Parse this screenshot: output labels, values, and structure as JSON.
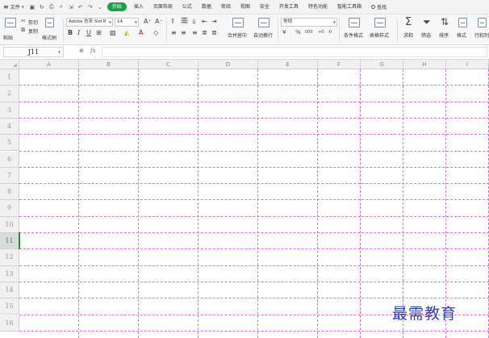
{
  "menubar": {
    "file_label": "文件",
    "tabs": [
      {
        "label": "开始",
        "active": true
      },
      {
        "label": "插入",
        "active": false
      },
      {
        "label": "页面布局",
        "active": false
      },
      {
        "label": "公式",
        "active": false
      },
      {
        "label": "数据",
        "active": false
      },
      {
        "label": "审阅",
        "active": false
      },
      {
        "label": "视图",
        "active": false
      },
      {
        "label": "安全",
        "active": false
      },
      {
        "label": "开发工具",
        "active": false
      },
      {
        "label": "特色功能",
        "active": false
      },
      {
        "label": "智能工具箱",
        "active": false
      }
    ],
    "search_label": "查找",
    "accent_color": "#1e9e4a"
  },
  "ribbon": {
    "paste": "粘贴",
    "cut": "剪切",
    "copy": "复制",
    "format_painter": "格式刷",
    "font_name": "Adobe 仿宋 Std R",
    "font_size": "14",
    "bold": "B",
    "italic": "I",
    "underline": "U",
    "increase_font": "A⁺",
    "decrease_font": "A⁻",
    "merge_center": "合并居中",
    "wrap_text": "自动换行",
    "number_format": "常规",
    "currency": "¥",
    "percent": "%",
    "thousands": "000",
    "inc_decimal": "+0",
    "dec_decimal": "-0",
    "conditional_format": "条件格式",
    "table_style": "表格样式",
    "sum": "求和",
    "filter": "筛选",
    "sort": "排序",
    "format": "格式",
    "rows_cols": "行和列"
  },
  "formula_bar": {
    "cell_ref": "J11",
    "fx": "fx",
    "value": ""
  },
  "grid": {
    "columns": [
      "A",
      "B",
      "C",
      "D",
      "E",
      "F",
      "G",
      "H",
      "I"
    ],
    "rows": [
      "1",
      "2",
      "3",
      "4",
      "5",
      "6",
      "7",
      "8",
      "9",
      "10",
      "11",
      "12",
      "13",
      "14",
      "15",
      "16"
    ],
    "active_row": "11",
    "gridline_color": "#e070d6"
  },
  "watermark": "最需教育"
}
